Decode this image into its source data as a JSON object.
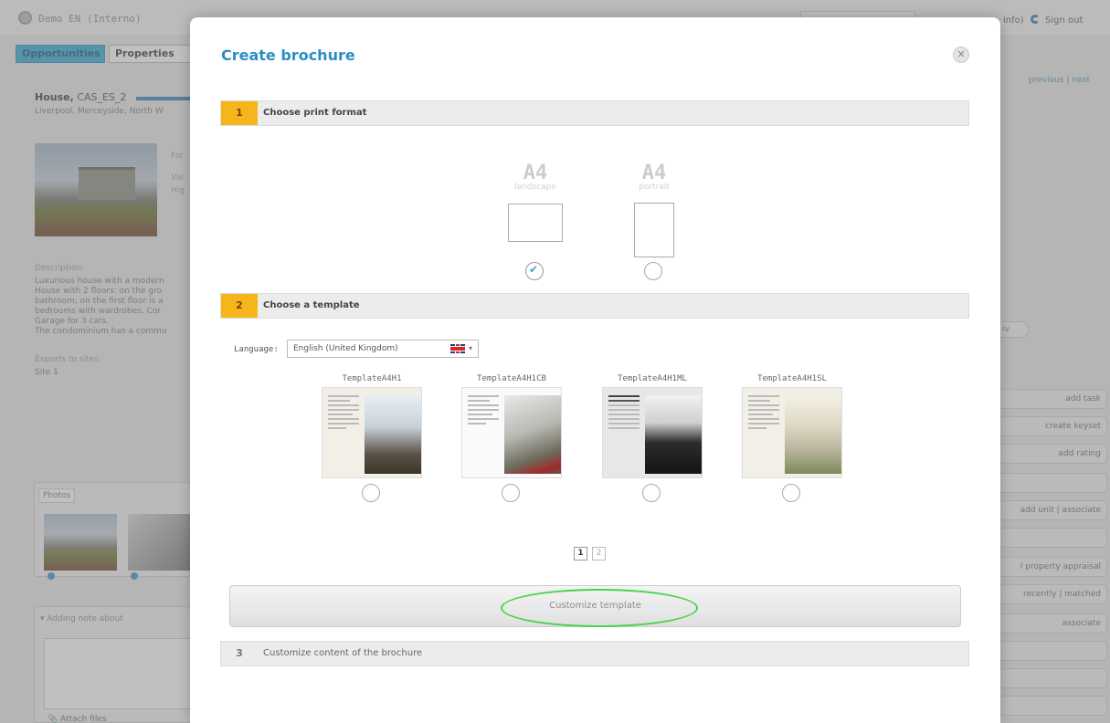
{
  "app": {
    "title": "Demo EN (Interno)",
    "top_right": "info)",
    "signout": "Sign out"
  },
  "tabs": [
    "Opportunities",
    "Properties"
  ],
  "property": {
    "title_bold": "House,",
    "title_ref": "CAS_ES_2",
    "location": "Liverpool, Merceyside, North W",
    "side_lines": [
      "For",
      "Vie",
      "Hig"
    ],
    "description_label": "Description:",
    "description_lines": [
      "Luxurious house with a modern",
      "House with 2 floors: on the gro",
      "bathroom; on the first floor is a",
      "bedrooms with wardrobes. Cor",
      "Garage for 3 cars.",
      "The condominium has a commu"
    ],
    "exports_label": "Exports to sites:",
    "site": "Site 1"
  },
  "photos_tab": "Photos",
  "note": {
    "header": "Adding note about",
    "attach": "Attach files"
  },
  "nav": {
    "prevnext": "previous | next"
  },
  "right_round": "iv",
  "actions": [
    "add task",
    "create keyset",
    "add rating",
    "",
    "add unit | associate",
    "",
    "l property appraisal",
    "recently | matched",
    "associate",
    "",
    "",
    ""
  ],
  "modal": {
    "title": "Create brochure",
    "close": "×",
    "step1": {
      "num": "1",
      "label": "Choose print format"
    },
    "step2": {
      "num": "2",
      "label": "Choose a template"
    },
    "step3": {
      "num": "3",
      "label": "Customize content of the brochure"
    },
    "formats": [
      {
        "size": "A4",
        "orientation": "landscape",
        "selected": true
      },
      {
        "size": "A4",
        "orientation": "portrait",
        "selected": false
      }
    ],
    "language_label": "Language:",
    "language_value": "English (United Kingdom)",
    "templates": [
      "TemplateA4H1",
      "TemplateA4H1CB",
      "TemplateA4H1ML",
      "TemplateA4H1SL"
    ],
    "pages": [
      "1",
      "2"
    ],
    "customize_button": "Customize template"
  },
  "colors": {
    "accent": "#2b8ec4",
    "step_number": "#f7b51c",
    "highlight": "#4bd24b",
    "tab_active": "#2ba6d6"
  }
}
